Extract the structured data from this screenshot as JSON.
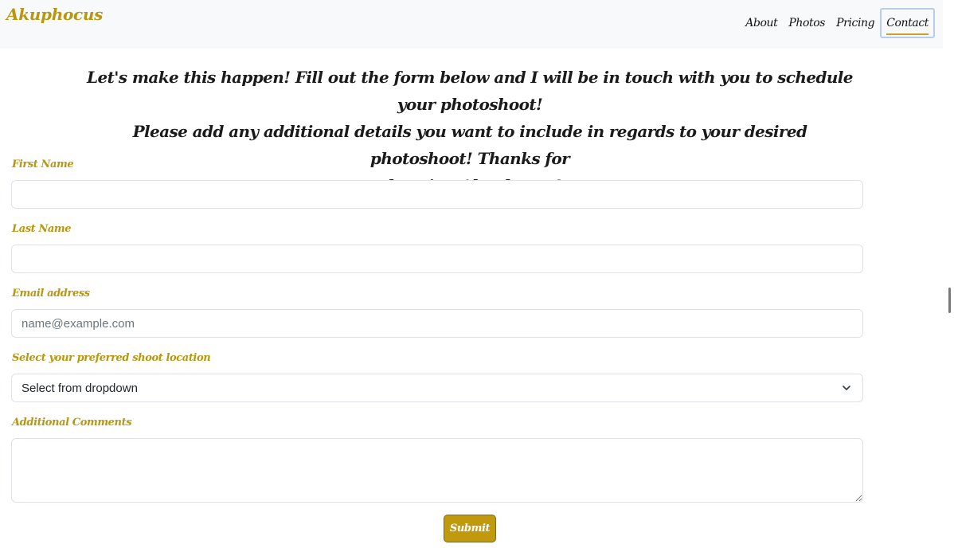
{
  "navbar": {
    "brand": "Akuphocus",
    "links": [
      "About",
      "Photos",
      "Pricing",
      "Contact"
    ],
    "active": "Contact"
  },
  "intro": {
    "line1": "Let's make this happen! Fill out the form below and I will be in touch with you to schedule your photoshoot!",
    "line2": "Please add any additional details you want to include in regards to your desired photoshoot! Thanks for",
    "line3": "choosing Akuphocus!"
  },
  "form": {
    "first_name_label": "First Name",
    "first_name_value": "",
    "last_name_label": "Last Name",
    "last_name_value": "",
    "email_label": "Email address",
    "email_placeholder": "name@example.com",
    "location_label": "Select your preferred shoot location",
    "location_selected": "Select from dropdown",
    "comments_label": "Additional Comments",
    "comments_value": "",
    "submit_label": "Submit"
  },
  "colors": {
    "accent": "#b8960f",
    "button": "#c09a0c",
    "navbar_bg": "#f8f9fa"
  },
  "icons": {
    "select_arrow": "chevron-down-icon"
  }
}
